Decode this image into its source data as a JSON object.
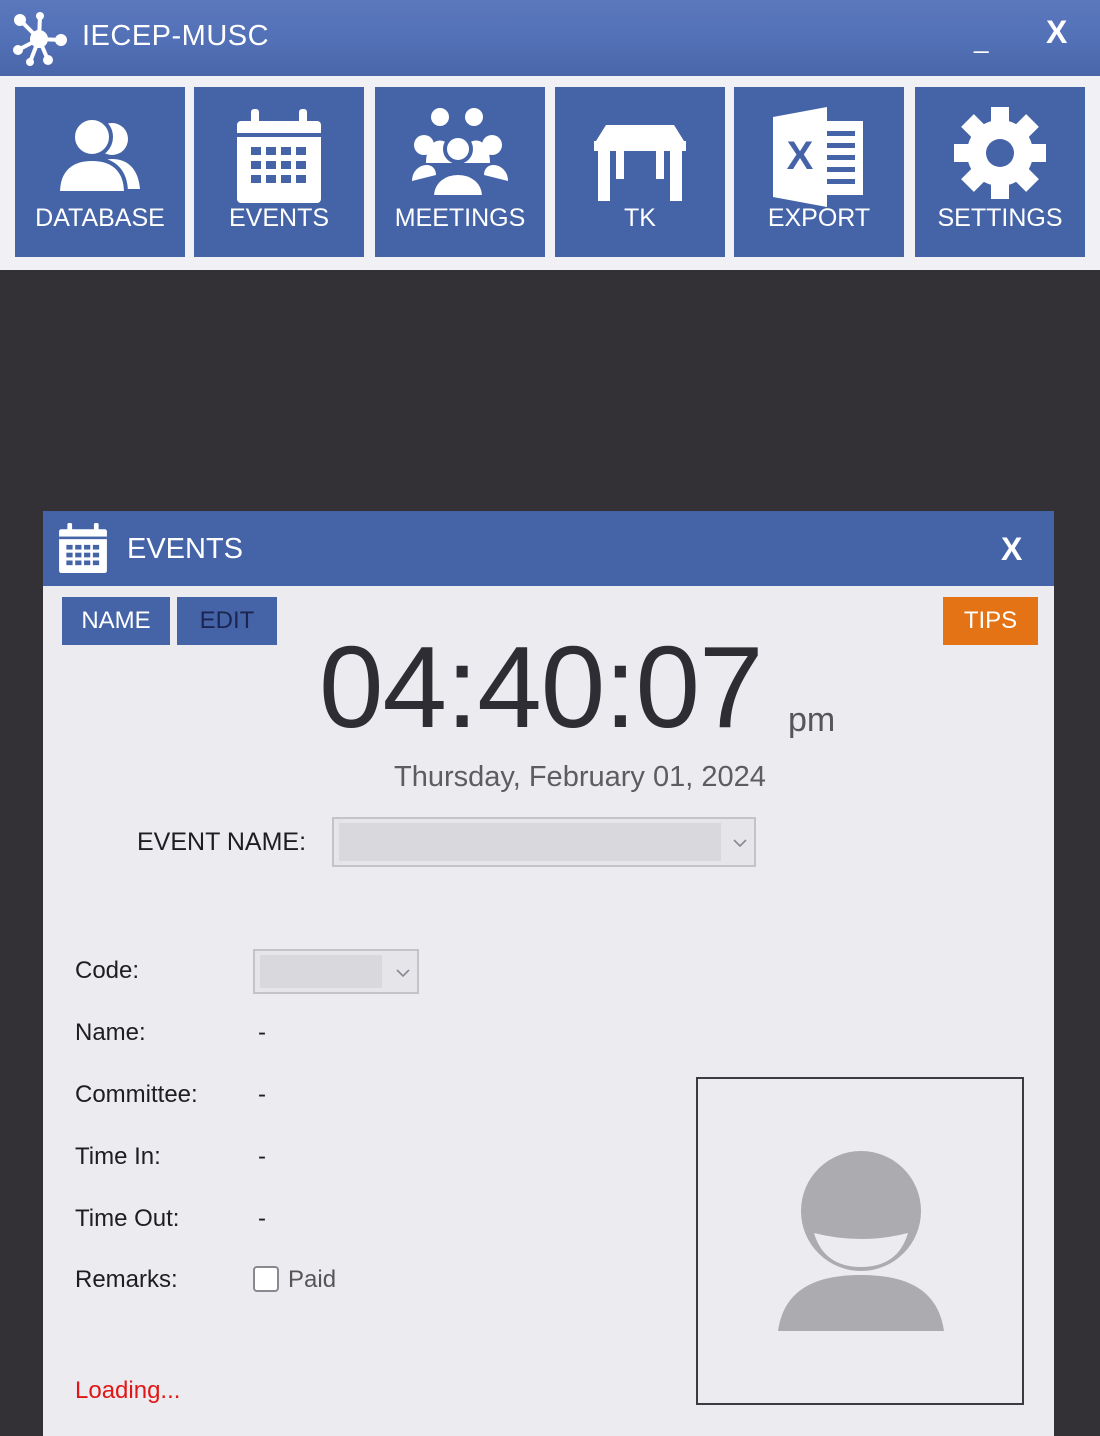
{
  "app": {
    "title": "IECEP-MUSC",
    "minimize_label": "_",
    "close_label": "X"
  },
  "toolbar": {
    "items": [
      {
        "label": "DATABASE",
        "icon": "users-icon"
      },
      {
        "label": "EVENTS",
        "icon": "calendar-icon"
      },
      {
        "label": "MEETINGS",
        "icon": "group-icon"
      },
      {
        "label": "TK",
        "icon": "table-icon"
      },
      {
        "label": "EXPORT",
        "icon": "excel-icon"
      },
      {
        "label": "SETTINGS",
        "icon": "gear-icon"
      }
    ]
  },
  "events_window": {
    "title": "EVENTS",
    "close_label": "X",
    "name_button": "NAME",
    "edit_button": "EDIT",
    "tips_button": "TIPS",
    "clock_time": "04:40:07",
    "clock_ampm": "pm",
    "date": "Thursday, February 01, 2024",
    "event_name_label": "EVENT NAME:",
    "event_name_value": "",
    "fields": {
      "code_label": "Code:",
      "code_value": "",
      "name_label": "Name:",
      "name_value": "-",
      "committee_label": "Committee:",
      "committee_value": "-",
      "time_in_label": "Time In:",
      "time_in_value": "-",
      "time_out_label": "Time Out:",
      "time_out_value": "-",
      "remarks_label": "Remarks:",
      "paid_label": "Paid",
      "paid_checked": false
    },
    "status": "Loading..."
  },
  "colors": {
    "accent": "#4564a8",
    "tips": "#e37315",
    "status": "#e01717",
    "background": "#333135"
  }
}
